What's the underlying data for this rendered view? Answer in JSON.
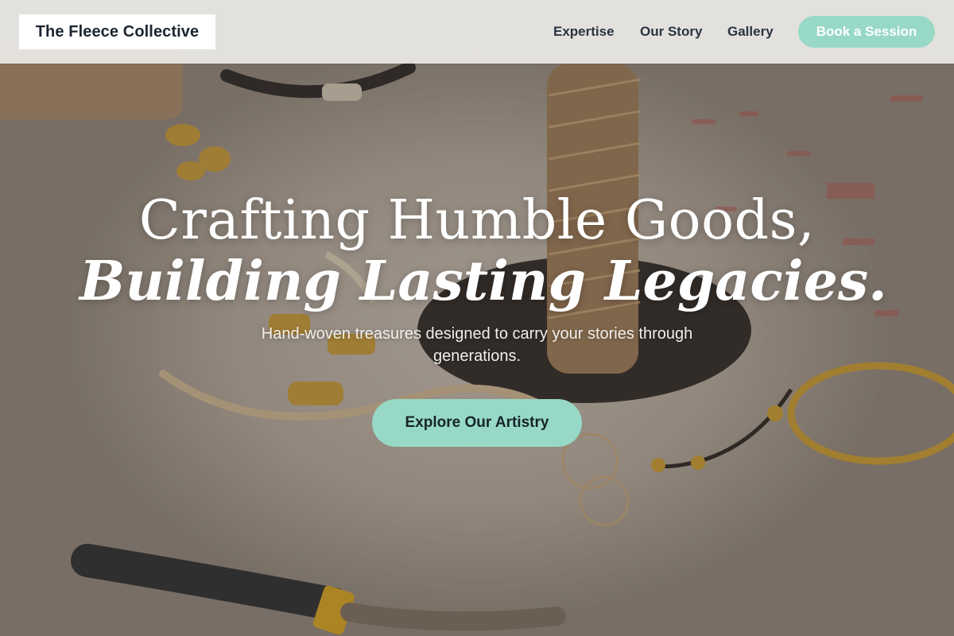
{
  "header": {
    "brand": "The Fleece Collective",
    "nav": [
      {
        "label": "Expertise"
      },
      {
        "label": "Our Story"
      },
      {
        "label": "Gallery"
      }
    ],
    "cta_label": "Book a Session"
  },
  "hero": {
    "headline_line1": "Crafting Humble Goods,",
    "headline_line2": "Building Lasting Legacies.",
    "subtitle": "Hand-woven treasures designed to carry your stories through generations.",
    "cta_label": "Explore Our Artistry",
    "background_image": "jewelry-crafting-table-photo"
  },
  "colors": {
    "accent": "#97d9c6",
    "navbar_bg": "#eceae6",
    "brand_text": "#1c2630",
    "nav_text": "#2a3440"
  }
}
